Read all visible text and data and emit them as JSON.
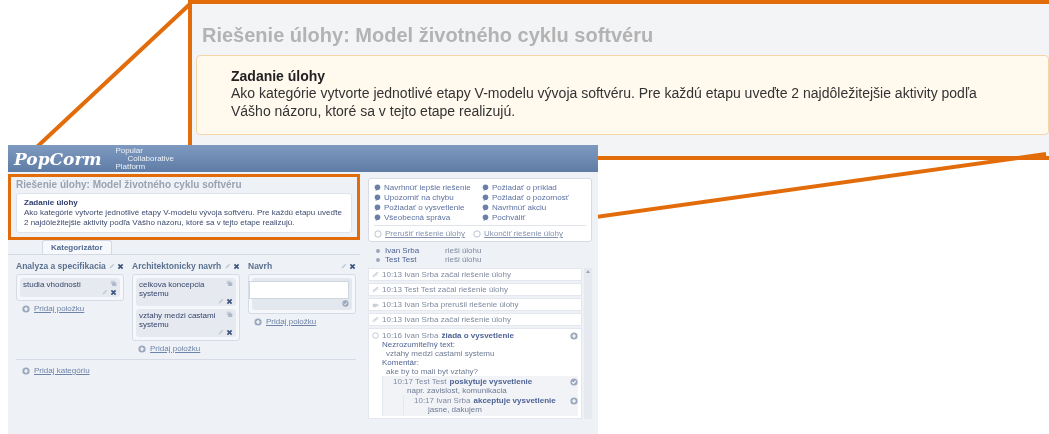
{
  "callout": {
    "title": "Riešenie úlohy: Model životného cyklu softvéru",
    "task": {
      "heading": "Zadanie úlohy",
      "text": "Ako kategórie vytvorte jednotlivé etapy V-modelu vývoja softvéru. Pre každú etapu uveďte 2 najdôležitejšie aktivity podľa Vášho názoru, ktoré sa v tejto etape realizujú."
    }
  },
  "app": {
    "logo": "PopCorm",
    "tagline": [
      "Popular",
      "Collaborative",
      "Platform"
    ],
    "title": "Riešenie úlohy: Model životného cyklu softvéru",
    "task": {
      "heading": "Zadanie úlohy",
      "text": "Ako kategórie vytvorte jednotlivé etapy V-modelu vývoja softvéru. Pre každú etapu uveďte 2 najdôležitejšie aktivity podľa Vášho názoru, ktoré sa v tejto etape realizujú."
    },
    "tabs": [
      {
        "label": "Kategorizátor",
        "selected": true
      }
    ],
    "categories": [
      {
        "name": "Analyza a specifikacia",
        "items": [
          {
            "text": "studia vhodnosti"
          }
        ],
        "draft": false,
        "add_label": "Pridaj položku"
      },
      {
        "name": "Architektonicky navrh",
        "items": [
          {
            "text": "celkova koncepcia systemu"
          },
          {
            "text": "vztahy medzi castami systemu"
          }
        ],
        "draft": false,
        "add_label": "Pridaj položku"
      },
      {
        "name": "Navrh",
        "draft": true,
        "add_label": "Pridaj položku"
      }
    ],
    "add_category": "Pridaj kategóriu",
    "actions": [
      "Navrhnúť lepšie riešenie",
      "Požiadať o príklad",
      "Upozorniť na chybu",
      "Požiadať o pozornosť",
      "Požiadať o vysvetlenie",
      "Navrhnúť akciu",
      "Všeobecná správa",
      "Pochváliť"
    ],
    "controls": [
      "Prerušiť riešenie úlohy",
      "Ukončiť riešenie úlohy"
    ],
    "users": [
      {
        "name": "Ivan Srba",
        "status": "rieši úlohu"
      },
      {
        "name": "Test Test",
        "status": "rieši úlohu"
      }
    ],
    "log": [
      {
        "kind": "start",
        "text": "10:13 Ivan Srba začal riešenie úlohy"
      },
      {
        "kind": "start",
        "text": "10:13 Test Test začal riešenie úlohy"
      },
      {
        "kind": "pause",
        "text": "10:13 Ivan Srba prerušil riešenie úlohy"
      },
      {
        "kind": "start",
        "text": "10:13 Ivan Srba začal riešenie úlohy"
      },
      {
        "kind": "request",
        "who": "10:16 Ivan Srba",
        "action": "žiada o vysvetlenie",
        "details": [
          {
            "label": "Nezrozumiteľný text:",
            "value": "vztahy medzi castami systemu"
          },
          {
            "label": "Komentár:",
            "value": "ake by to mali byt vztahy?"
          }
        ],
        "children": [
          {
            "who": "10:17 Test Test",
            "action": "poskytuje vysvetlenie",
            "note": "napr. zavislost, komunikacia",
            "accepted": true,
            "children": [
              {
                "who": "10:17 Ivan Srba",
                "action": "akceptuje vysvetlenie",
                "note": "jasne, dakujem",
                "accepted": false
              }
            ]
          }
        ]
      }
    ]
  }
}
